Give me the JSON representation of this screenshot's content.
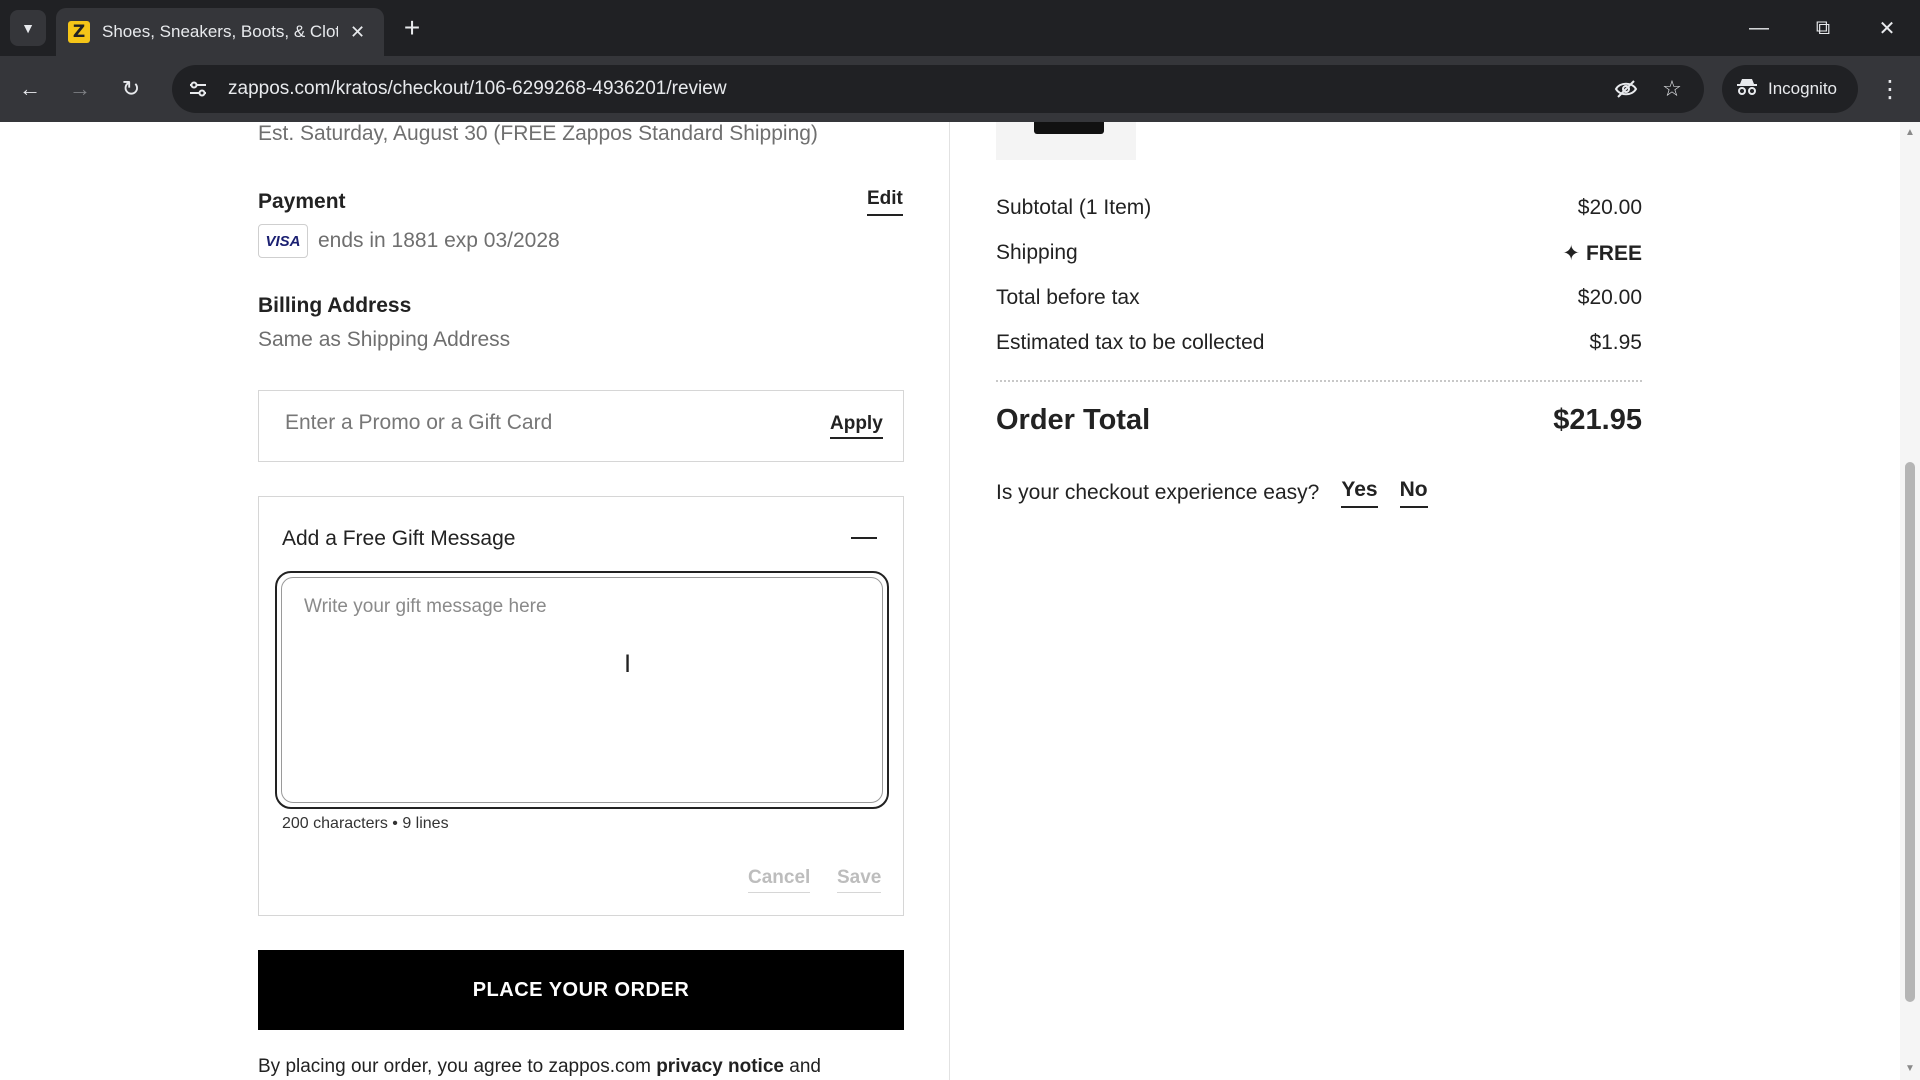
{
  "browser": {
    "tab_title": "Shoes, Sneakers, Boots, & Clothing",
    "favicon_letter": "Z",
    "url": "zappos.com/kratos/checkout/106-6299268-4936201/review",
    "incognito_label": "Incognito"
  },
  "left": {
    "delivery_estimate": "Est. Saturday, August 30 (FREE Zappos Standard Shipping)",
    "payment": {
      "title": "Payment",
      "edit_label": "Edit",
      "card_brand": "VISA",
      "card_text": "ends in 1881 exp 03/2028"
    },
    "billing": {
      "title": "Billing Address",
      "value": "Same as Shipping Address"
    },
    "promo": {
      "placeholder": "Enter a Promo or a Gift Card",
      "apply_label": "Apply"
    },
    "gift": {
      "title": "Add a Free Gift Message",
      "placeholder": "Write your gift message here",
      "limit": "200 characters • 9 lines",
      "cancel_label": "Cancel",
      "save_label": "Save"
    },
    "place_order_label": "PLACE YOUR ORDER",
    "agreement": {
      "prefix": "By placing our order, you agree to zappos.com",
      "link": "privacy notice",
      "suffix": "and"
    }
  },
  "summary": {
    "subtotal_label": "Subtotal (1 Item)",
    "subtotal_value": "$20.00",
    "shipping_label": "Shipping",
    "shipping_value": "FREE",
    "before_tax_label": "Total before tax",
    "before_tax_value": "$20.00",
    "tax_label": "Estimated tax to be collected",
    "tax_value": "$1.95",
    "total_label": "Order Total",
    "total_value": "$21.95"
  },
  "survey": {
    "question": "Is your checkout experience easy?",
    "yes": "Yes",
    "no": "No"
  }
}
